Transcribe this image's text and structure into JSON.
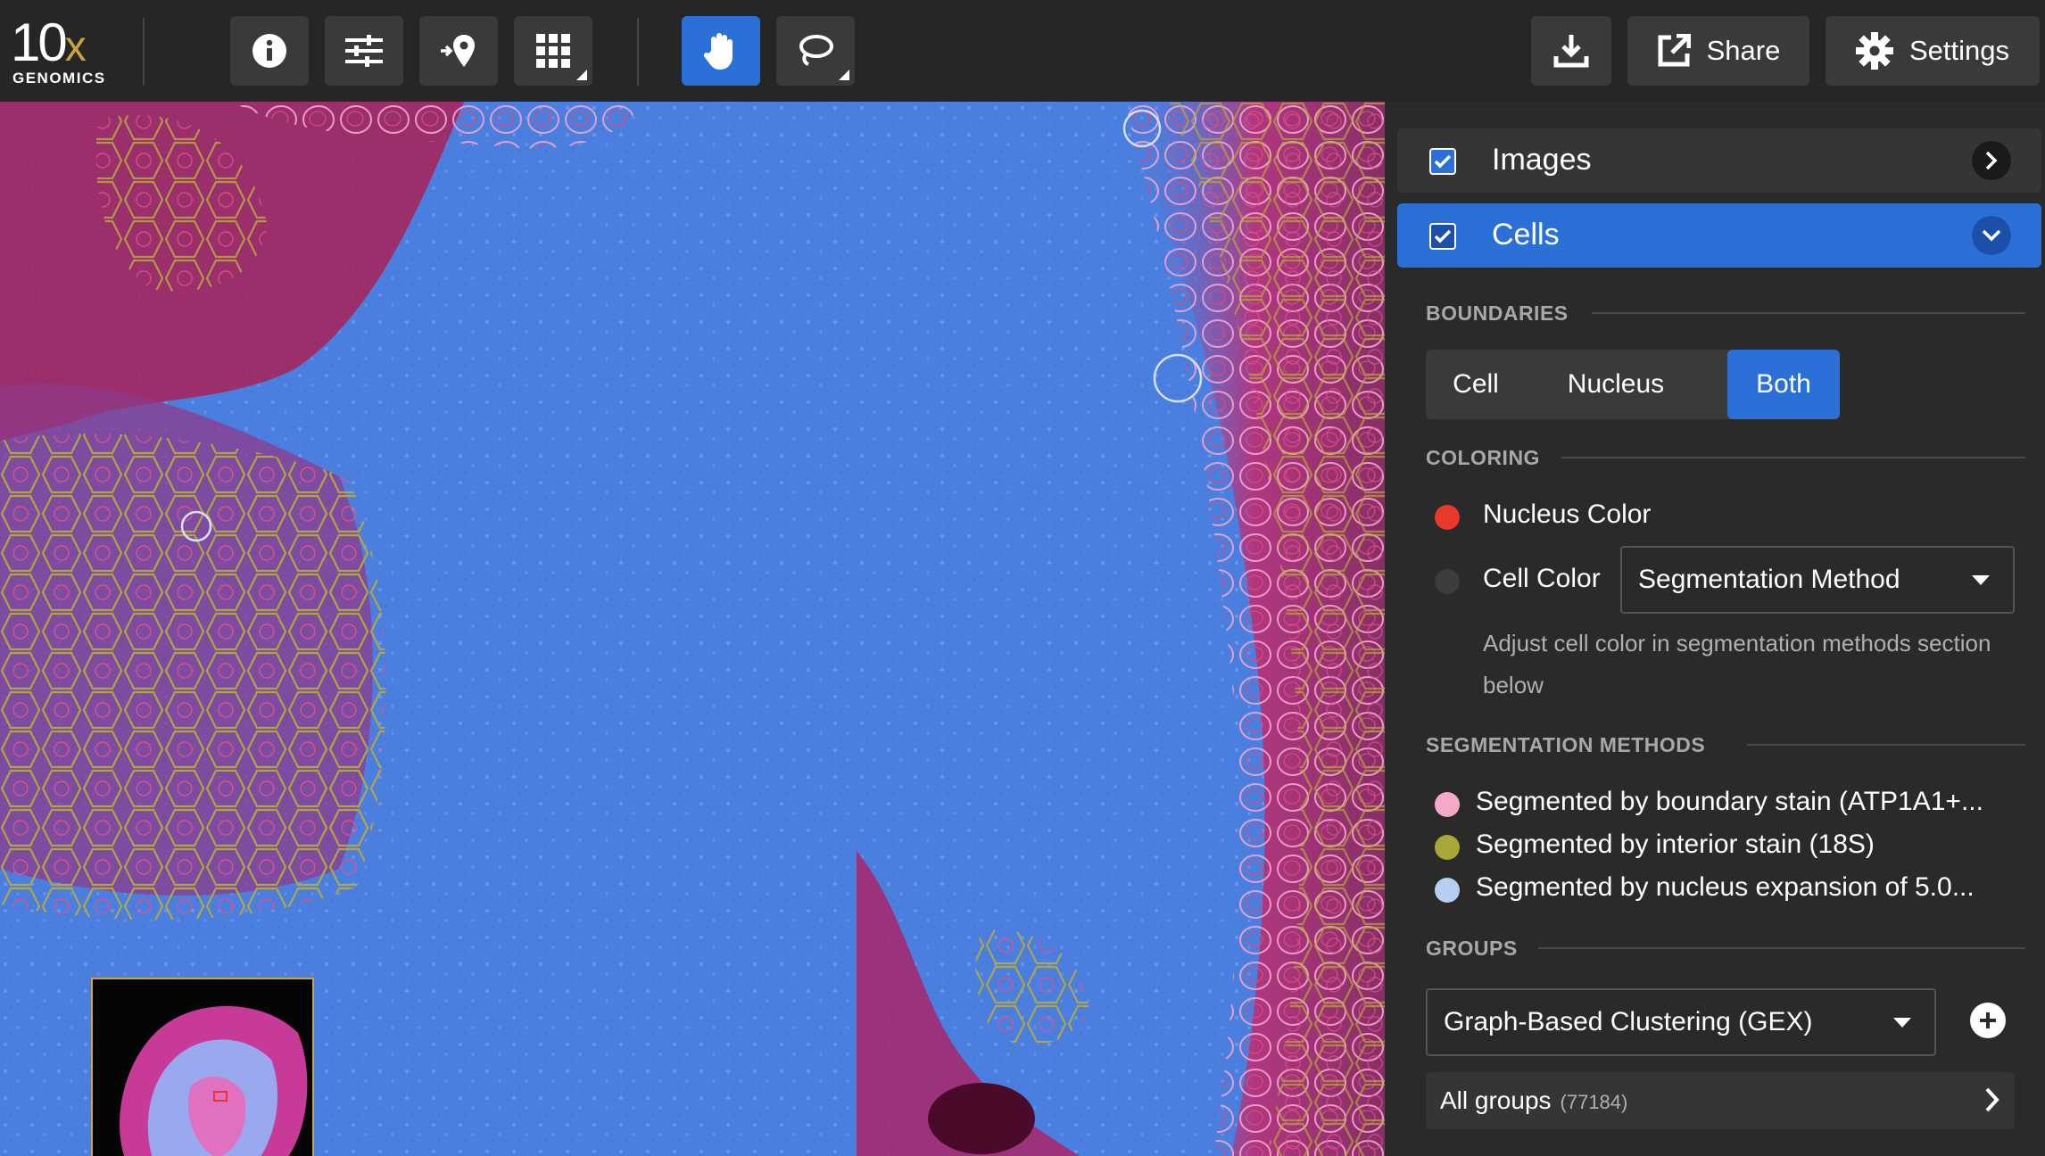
{
  "logo": {
    "main": "10",
    "x": "x",
    "sub": "GENOMICS"
  },
  "toolbar": {
    "share_label": "Share",
    "settings_label": "Settings"
  },
  "panel": {
    "layers": [
      {
        "label": "Images",
        "checked": true,
        "expanded": false
      },
      {
        "label": "Cells",
        "checked": true,
        "expanded": true
      }
    ],
    "boundaries": {
      "title": "BOUNDARIES",
      "options": [
        "Cell",
        "Nucleus",
        "Both"
      ],
      "selected": "Both"
    },
    "coloring": {
      "title": "COLORING",
      "nucleus_label": "Nucleus Color",
      "nucleus_color": "#e8392b",
      "cell_label": "Cell Color",
      "cell_color": "#3c3c3c",
      "cell_dropdown": "Segmentation Method",
      "hint": "Adjust cell color in segmentation methods section below"
    },
    "segmentation": {
      "title": "SEGMENTATION METHODS",
      "methods": [
        {
          "label": "Segmented by boundary stain (ATP1A1+...",
          "color": "#f4a9c8"
        },
        {
          "label": "Segmented by interior stain (18S)",
          "color": "#a8a83a"
        },
        {
          "label": "Segmented by nucleus expansion of 5.0...",
          "color": "#b8cdf4"
        }
      ]
    },
    "groups": {
      "title": "GROUPS",
      "dropdown": "Graph-Based Clustering (GEX)",
      "all_label": "All groups",
      "all_count": "(77184)"
    }
  },
  "colors": {
    "accent": "#2b70d6",
    "tissue_blue": "#4a7fe0",
    "tissue_magenta": "#b02a6e"
  },
  "icons": {
    "info": "info-icon",
    "adjust": "sliders-icon",
    "add_location": "location-pin-icon",
    "grid": "grid-icon",
    "pan": "hand-icon",
    "lasso": "lasso-icon",
    "download": "download-icon",
    "share": "external-link-icon",
    "settings": "gear-icon"
  }
}
